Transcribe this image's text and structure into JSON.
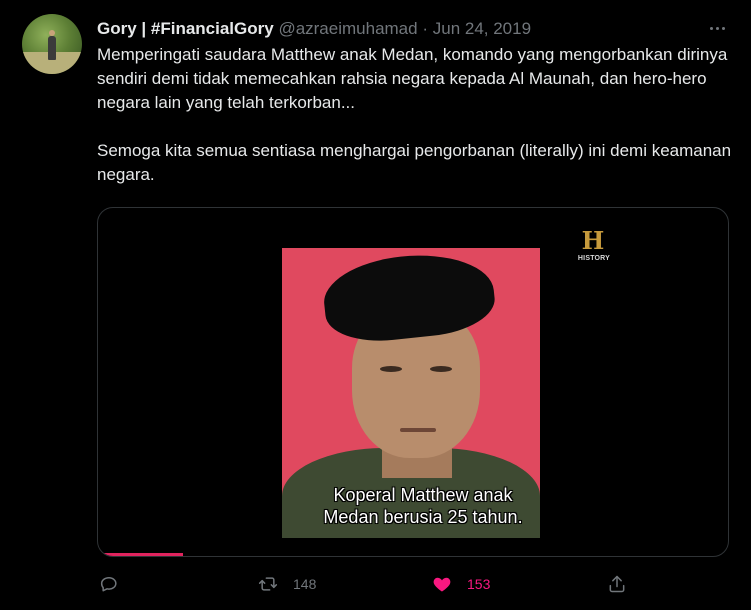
{
  "tweet": {
    "display_name": "Gory | #FinancialGory",
    "handle": "@azraeimuhamad",
    "separator": "·",
    "date": "Jun 24, 2019",
    "text_para1": "Memperingati saudara Matthew anak Medan, komando yang mengorbankan dirinya sendiri demi tidak memecahkan rahsia negara kepada Al Maunah, dan hero-hero negara lain yang telah terkorban...",
    "text_para2": "Semoga kita semua sentiasa menghargai pengorbanan (literally) ini demi keamanan negara."
  },
  "media": {
    "logo_letter": "H",
    "logo_text": "HISTORY",
    "caption_line1": "Koperal Matthew anak",
    "caption_line2": "Medan berusia 25 tahun.",
    "progress_fraction": 0.135
  },
  "actions": {
    "reply_icon": "reply-icon",
    "retweet_icon": "retweet-icon",
    "retweet_count": "148",
    "like_icon": "heart-icon",
    "like_count": "153",
    "share_icon": "share-icon",
    "liked": true
  },
  "colors": {
    "background": "#000000",
    "text_primary": "#e7e9ea",
    "text_secondary": "#71767b",
    "like_pink": "#f91880",
    "progress_red": "#e0245e"
  }
}
